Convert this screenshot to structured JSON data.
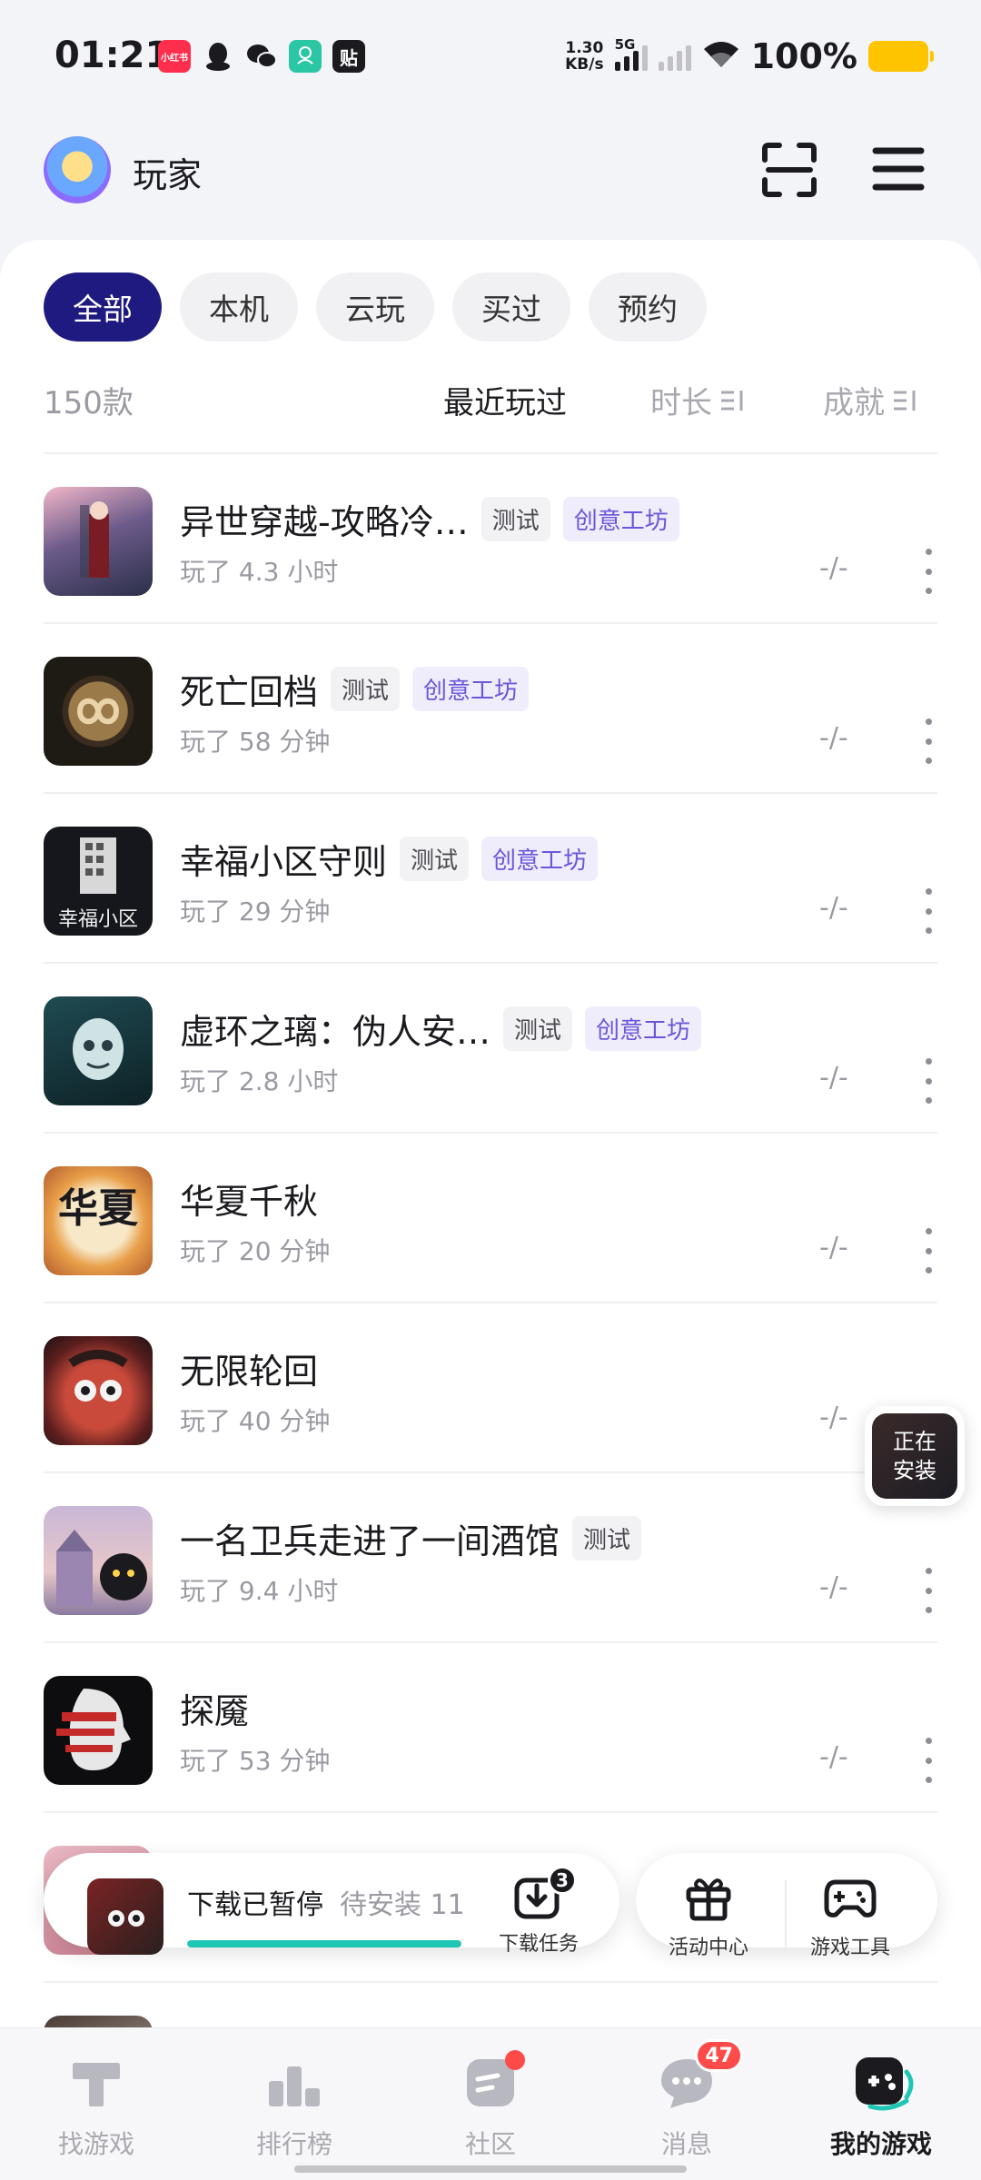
{
  "status_bar": {
    "time": "01:21",
    "net_speed_value": "1.30",
    "net_speed_unit": "KB/s",
    "network_type": "5G",
    "battery": "100%",
    "notification_icons": [
      "xiaohongshu-icon",
      "qq-icon",
      "wechat-icon",
      "ai-app-icon",
      "tieba-icon"
    ],
    "xiaohongshu_label": "小红书",
    "tieba_label": "贴"
  },
  "header": {
    "username": "玩家"
  },
  "filters": {
    "all": "全部",
    "local": "本机",
    "cloud": "云玩",
    "purchased": "买过",
    "reserved": "预约"
  },
  "list_header": {
    "count": "150款",
    "sort_recent": "最近玩过",
    "sort_duration": "时长",
    "sort_achievement": "成就"
  },
  "games": [
    {
      "title": "异世穿越-攻略冷…",
      "tag_test": "测试",
      "tag_workshop": "创意工坊",
      "played": "玩了 4.3 小时",
      "achievement": "-/-"
    },
    {
      "title": "死亡回档",
      "tag_test": "测试",
      "tag_workshop": "创意工坊",
      "played": "玩了 58 分钟",
      "achievement": "-/-"
    },
    {
      "title": "幸福小区守则",
      "tag_test": "测试",
      "tag_workshop": "创意工坊",
      "played": "玩了 29 分钟",
      "achievement": "-/-",
      "icon_text": "幸福小区"
    },
    {
      "title": "虚环之璃：伪人安…",
      "tag_test": "测试",
      "tag_workshop": "创意工坊",
      "played": "玩了 2.8 小时",
      "achievement": "-/-"
    },
    {
      "title": "华夏千秋",
      "played": "玩了 20 分钟",
      "achievement": "-/-",
      "icon_text": "华夏"
    },
    {
      "title": "无限轮回",
      "played": "玩了 40 分钟",
      "achievement": "-/-"
    },
    {
      "title": "一名卫兵走进了一间酒馆",
      "tag_test": "测试",
      "played": "玩了 9.4 小时",
      "achievement": "-/-"
    },
    {
      "title": "探魇",
      "played": "玩了 53 分钟",
      "achievement": "-/-"
    }
  ],
  "installing_badge": {
    "line1": "正在",
    "line2": "安装"
  },
  "download_bar": {
    "status": "下载已暂停",
    "pending": "待安装 11",
    "progress": 1.0,
    "task_label": "下载任务",
    "task_count": "3"
  },
  "tools_bar": {
    "activity_label": "活动中心",
    "game_tools_label": "游戏工具"
  },
  "tab_bar": {
    "find_games": "找游戏",
    "rankings": "排行榜",
    "community": "社区",
    "messages": "消息",
    "messages_count": "47",
    "my_games": "我的游戏"
  },
  "colors": {
    "accent": "#1e1a80",
    "workshop_tag": "#6a56d8",
    "progress": "#20c6b4",
    "badge_red": "#ff4a4a",
    "battery": "#ffc400"
  }
}
